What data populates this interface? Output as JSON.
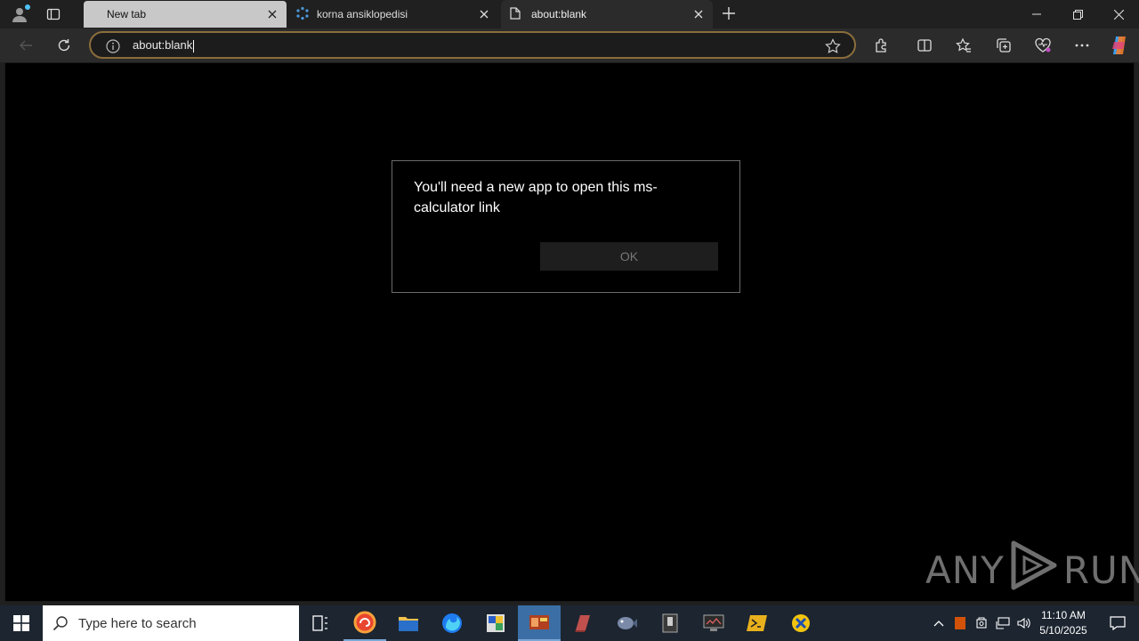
{
  "browser": {
    "tabs": [
      {
        "label": "New tab",
        "favicon": "none"
      },
      {
        "label": "korna ansiklopedisi",
        "favicon": "loading-icon"
      },
      {
        "label": "about:blank",
        "favicon": "page-icon"
      }
    ],
    "address": {
      "url": "about:blank"
    },
    "accent": "#8a6d3b"
  },
  "dialog": {
    "message": "You'll need a new app to open this ms-calculator link",
    "ok_label": "OK"
  },
  "watermark": {
    "left": "ANY",
    "right": "RUN"
  },
  "taskbar": {
    "search_placeholder": "Type here to search",
    "time": "11:10 AM",
    "date": "5/10/2025"
  }
}
